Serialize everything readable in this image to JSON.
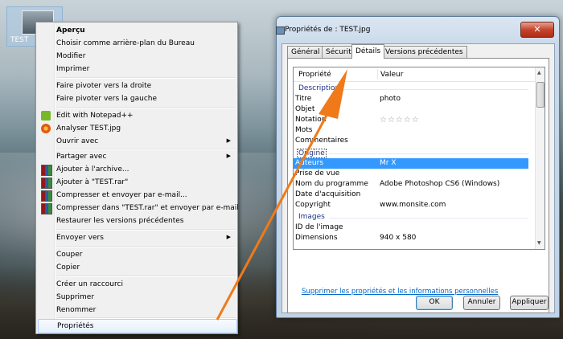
{
  "desktop": {
    "icon_label": "TEST",
    "icon_name": "image-file-icon"
  },
  "context_menu": {
    "items": [
      {
        "label": "Aperçu",
        "bold": true
      },
      {
        "label": "Choisir comme arrière-plan du Bureau"
      },
      {
        "label": "Modifier"
      },
      {
        "label": "Imprimer"
      },
      {
        "label": "Faire pivoter vers la droite"
      },
      {
        "label": "Faire pivoter vers la gauche"
      },
      {
        "label": "Edit with Notepad++",
        "icon": "notepad-plus-plus-icon"
      },
      {
        "label": "Analyser TEST.jpg",
        "icon": "avast-icon"
      },
      {
        "label": "Ouvrir avec",
        "submenu": true
      },
      {
        "label": "Partager avec",
        "submenu": true
      },
      {
        "label": "Ajouter à l'archive...",
        "icon": "winrar-icon"
      },
      {
        "label": "Ajouter à \"TEST.rar\"",
        "icon": "winrar-icon"
      },
      {
        "label": "Compresser et envoyer par e-mail...",
        "icon": "winrar-icon"
      },
      {
        "label": "Compresser dans \"TEST.rar\" et envoyer par e-mail",
        "icon": "winrar-icon"
      },
      {
        "label": "Restaurer les versions précédentes"
      },
      {
        "label": "Envoyer vers",
        "submenu": true
      },
      {
        "label": "Couper"
      },
      {
        "label": "Copier"
      },
      {
        "label": "Créer un raccourci"
      },
      {
        "label": "Supprimer"
      },
      {
        "label": "Renommer"
      },
      {
        "label": "Propriétés"
      }
    ],
    "submenu_arrow": "▶"
  },
  "properties_window": {
    "title": "Propriétés de : TEST.jpg",
    "close_label": "✕",
    "tabs": [
      "Général",
      "Sécurité",
      "Détails",
      "Versions précédentes"
    ],
    "active_tab": "Détails",
    "columns": {
      "property": "Propriété",
      "value": "Valeur"
    },
    "groups": {
      "description": "Description",
      "origin": "Origine",
      "images": "Images"
    },
    "rows": [
      {
        "property": "Titre",
        "value": "photo"
      },
      {
        "property": "Objet",
        "value": ""
      },
      {
        "property": "Notation",
        "value": "☆☆☆☆☆"
      },
      {
        "property": "Mots",
        "value": ""
      },
      {
        "property": "Commentaires",
        "value": ""
      },
      {
        "property": "Auteurs",
        "value": "Mr X",
        "selected": true
      },
      {
        "property": "Prise de vue",
        "value": ""
      },
      {
        "property": "Nom du programme",
        "value": "Adobe Photoshop CS6 (Windows)"
      },
      {
        "property": "Date d'acquisition",
        "value": ""
      },
      {
        "property": "Copyright",
        "value": "www.monsite.com"
      },
      {
        "property": "ID de l'image",
        "value": ""
      },
      {
        "property": "Dimensions",
        "value": "940 x 580"
      }
    ],
    "remove_link": "Supprimer les propriétés et les informations personnelles",
    "buttons": {
      "ok": "OK",
      "cancel": "Annuler",
      "apply": "Appliquer"
    }
  },
  "colors": {
    "annotation_arrow": "#f07a1a",
    "selection": "#3399ff",
    "group_header": "#1e3287"
  }
}
